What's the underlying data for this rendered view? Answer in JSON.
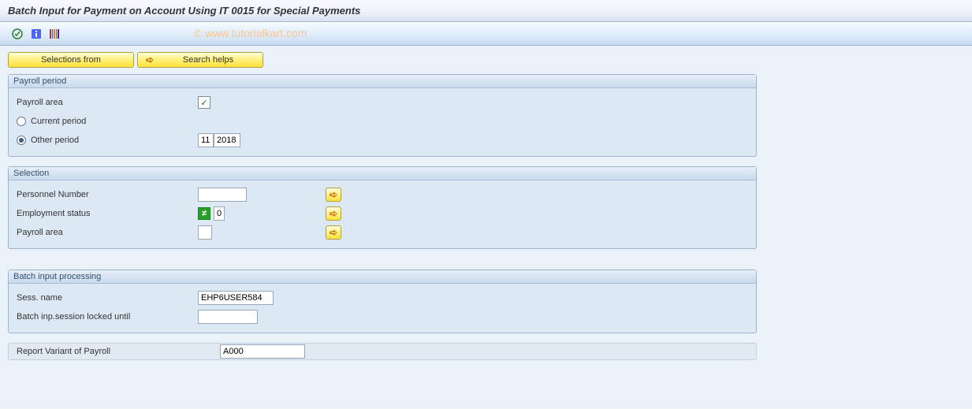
{
  "header": {
    "title": "Batch Input for Payment on Account Using IT 0015 for Special Payments"
  },
  "watermark": "© www.tutorialkart.com",
  "buttons": {
    "selections_from": "Selections from",
    "search_helps": "Search helps"
  },
  "group_payroll": {
    "title": "Payroll period",
    "payroll_area_label": "Payroll area",
    "payroll_area_checked": "✓",
    "current_period_label": "Current period",
    "other_period_label": "Other period",
    "other_period_month": "11",
    "other_period_year": "2018"
  },
  "group_selection": {
    "title": "Selection",
    "personnel_number_label": "Personnel Number",
    "employment_status_label": "Employment status",
    "employment_status_value": "0",
    "payroll_area_label": "Payroll area"
  },
  "group_batch": {
    "title": "Batch input processing",
    "sess_name_label": "Sess. name",
    "sess_name_value": "EHP6USER584",
    "locked_until_label": "Batch inp.session locked until"
  },
  "report_variant": {
    "label": "Report Variant of Payroll",
    "value": "A000"
  }
}
